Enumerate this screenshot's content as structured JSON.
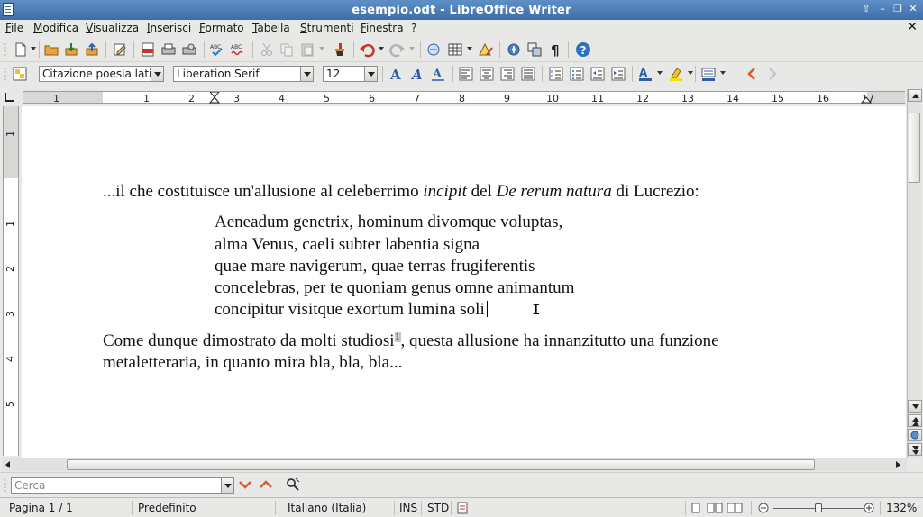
{
  "window": {
    "title": "esempio.odt - LibreOffice Writer",
    "buttons": {
      "up": "⇧",
      "minimize": "–",
      "maximize": "❐",
      "close": "✕"
    }
  },
  "menubar": {
    "items": [
      "File",
      "Modifica",
      "Visualizza",
      "Inserisci",
      "Formato",
      "Tabella",
      "Strumenti",
      "Finestra",
      "?"
    ],
    "close_document": "✕"
  },
  "formatting": {
    "paragraph_style": "Citazione poesia latin",
    "font_name": "Liberation Serif",
    "font_size": "12"
  },
  "ruler": {
    "labels": [
      "1",
      "1",
      "2",
      "3",
      "4",
      "5",
      "6",
      "7",
      "8",
      "9",
      "10",
      "11",
      "12",
      "13",
      "14",
      "15",
      "16",
      "17"
    ],
    "vertical_labels": [
      "1",
      "1",
      "2",
      "3",
      "4",
      "5"
    ]
  },
  "document": {
    "para1": {
      "a": "...il che costituisce un'allusione al celeberrimo ",
      "b": "incipit",
      "c": " del ",
      "d": "De rerum natura",
      "e": " di Lucrezio:"
    },
    "poem": [
      "Aeneadum genetrix, hominum divomque voluptas,",
      "alma Venus, caeli subter labentia signa",
      "quae mare navigerum, quae terras frugiferentis",
      "concelebras, per te quoniam genus omne animantum",
      "concipitur visitque exortum lumina soli"
    ],
    "para2": {
      "line1_a": "Come dunque dimostrato da molti studiosi",
      "footnote": "1",
      "line1_b": ", questa allusione ha innanzitutto una funzione",
      "line2": "metaletteraria, in quanto mira bla, bla, bla..."
    }
  },
  "find": {
    "placeholder": "Cerca"
  },
  "statusbar": {
    "page": "Pagina 1 / 1",
    "page_style": "Predefinito",
    "language": "Italiano (Italia)",
    "insert_mode": "INS",
    "selection_mode": "STD",
    "zoom": "132%"
  },
  "colors": {
    "titlebar": "#3d6ea8",
    "chrome": "#e8e8e7",
    "page": "#ffffff"
  }
}
